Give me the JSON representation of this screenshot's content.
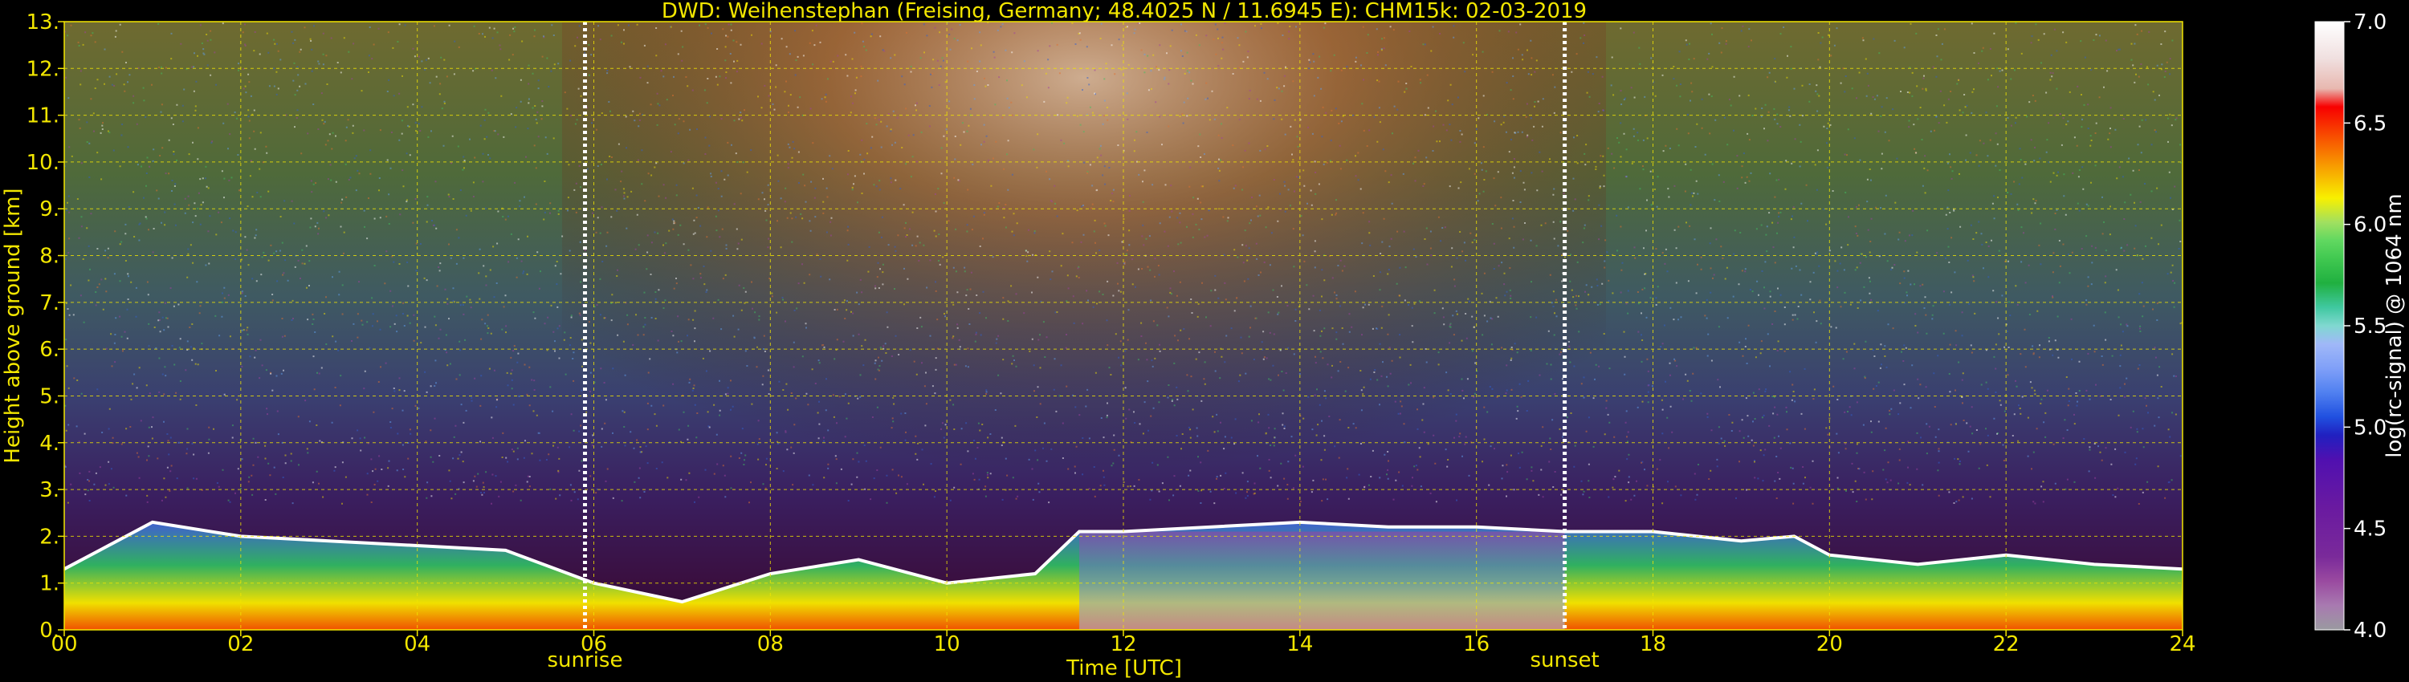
{
  "chart_data": {
    "type": "heatmap",
    "title": "DWD: Weihenstephan (Freising, Germany; 48.4025 N / 11.6945 E):    CHM15k: 02-03-2019",
    "xlabel": "Time [UTC]",
    "ylabel": "Height above ground [km]",
    "colorbar_label": "log(rc-signal) @ 1064 nm",
    "xlim": [
      0,
      24
    ],
    "ylim": [
      0,
      13
    ],
    "x_ticks": [
      0,
      2,
      4,
      6,
      8,
      10,
      12,
      14,
      16,
      18,
      20,
      22,
      24
    ],
    "x_tick_labels": [
      "00",
      "02",
      "04",
      "06",
      "08",
      "10",
      "12",
      "14",
      "16",
      "18",
      "20",
      "22",
      "24"
    ],
    "y_ticks": [
      0,
      1,
      2,
      3,
      4,
      5,
      6,
      7,
      8,
      9,
      10,
      11,
      12,
      13
    ],
    "y_tick_labels": [
      "0.",
      "1.",
      "2.",
      "3.",
      "4.",
      "5.",
      "6.",
      "7.",
      "8.",
      "9.",
      "10.",
      "11.",
      "12.",
      "13."
    ],
    "colorbar_range": [
      4.0,
      7.0
    ],
    "colorbar_ticks": [
      4.0,
      4.5,
      5.0,
      5.5,
      6.0,
      6.5,
      7.0
    ],
    "colorbar_tick_labels": [
      "4.0",
      "4.5",
      "5.0",
      "5.5",
      "6.0",
      "6.5",
      "7.0"
    ],
    "colormap": [
      "#9a9aa0",
      "#a87ab0",
      "#9a4aa0",
      "#7a2a9a",
      "#6a1aa0",
      "#5010b0",
      "#2020c0",
      "#2050e0",
      "#5080f0",
      "#80a0f8",
      "#a0b8f8",
      "#80d8d0",
      "#40c8a0",
      "#20b040",
      "#40c850",
      "#60d860",
      "#a0e060",
      "#f8f000",
      "#f8c000",
      "#f89000",
      "#f86000",
      "#f83000",
      "#f80000",
      "#e8b8b0",
      "#f0e0e0",
      "#ffffff"
    ],
    "grid": true,
    "markers": [
      {
        "label": "sunrise",
        "x": 5.9
      },
      {
        "label": "sunset",
        "x": 17.0
      }
    ],
    "cloud_base_km": [
      [
        0.0,
        1.3
      ],
      [
        1.0,
        2.3
      ],
      [
        2.0,
        2.0
      ],
      [
        3.0,
        1.9
      ],
      [
        4.0,
        1.8
      ],
      [
        5.0,
        1.7
      ],
      [
        6.0,
        1.0
      ],
      [
        7.0,
        0.6
      ],
      [
        8.0,
        1.2
      ],
      [
        9.0,
        1.5
      ],
      [
        10.0,
        1.0
      ],
      [
        11.0,
        1.2
      ],
      [
        11.5,
        2.1
      ],
      [
        12.0,
        2.1
      ],
      [
        13.0,
        2.2
      ],
      [
        14.0,
        2.3
      ],
      [
        15.0,
        2.2
      ],
      [
        16.0,
        2.2
      ],
      [
        17.0,
        2.1
      ],
      [
        18.0,
        2.1
      ],
      [
        19.0,
        1.9
      ],
      [
        19.6,
        2.0
      ],
      [
        20.0,
        1.6
      ],
      [
        21.0,
        1.4
      ],
      [
        22.0,
        1.6
      ],
      [
        23.0,
        1.4
      ],
      [
        24.0,
        1.3
      ]
    ]
  }
}
